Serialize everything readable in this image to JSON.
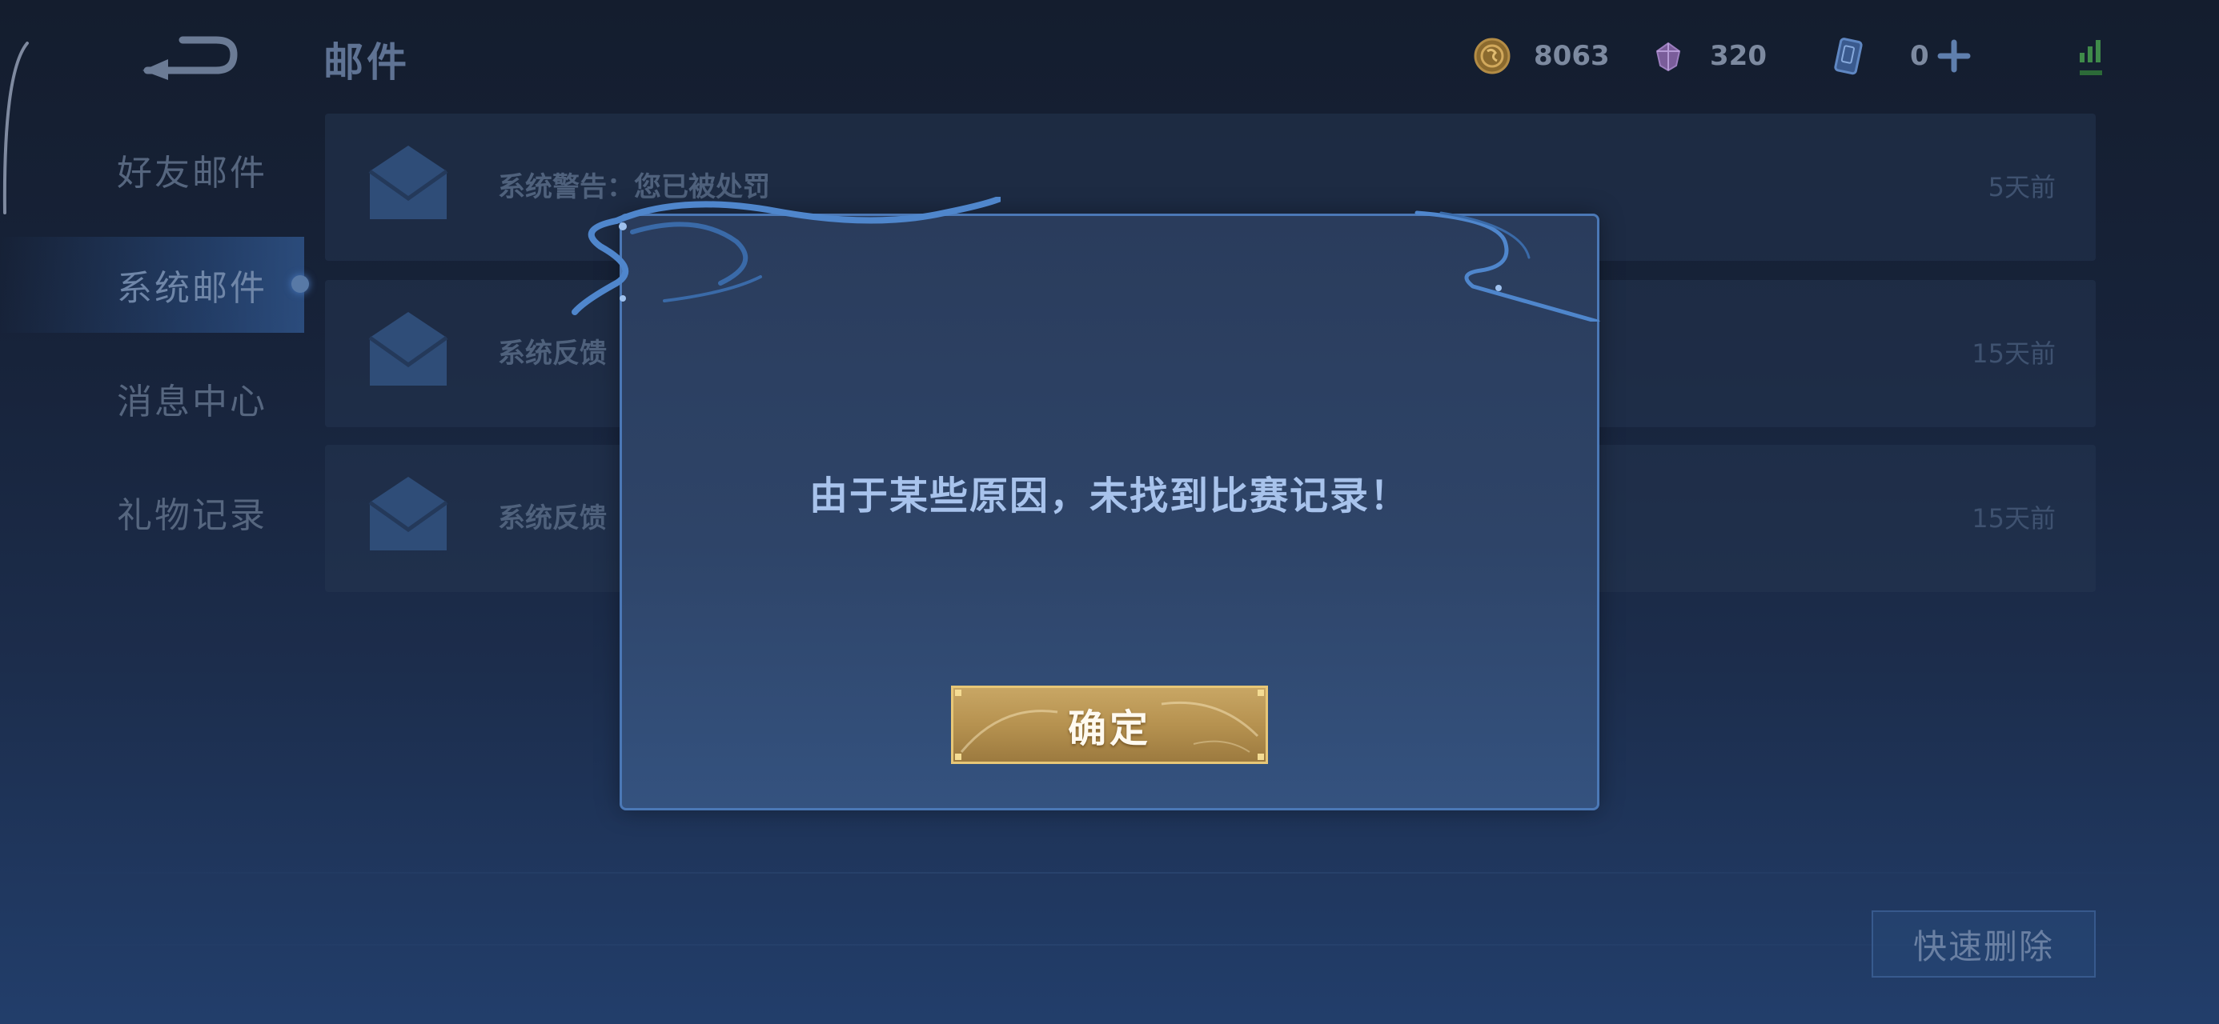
{
  "header": {
    "title": "邮件",
    "gold": "8063",
    "gems": "320",
    "tickets": "0"
  },
  "sidebar": {
    "items": [
      {
        "label": "好友邮件"
      },
      {
        "label": "系统邮件"
      },
      {
        "label": "消息中心"
      },
      {
        "label": "礼物记录"
      }
    ]
  },
  "mails": [
    {
      "title": "系统警告：您已被处罚",
      "time": "5天前"
    },
    {
      "title": "系统反馈",
      "time": "15天前"
    },
    {
      "title": "系统反馈",
      "time": "15天前"
    }
  ],
  "quick_delete_label": "快速删除",
  "dialog": {
    "message": "由于某些原因，未找到比赛记录！",
    "confirm_label": "确定"
  },
  "colors": {
    "accent_gold": "#e7c777",
    "dialog_border": "#4b78b6",
    "dialog_text": "#a8c3ec"
  }
}
